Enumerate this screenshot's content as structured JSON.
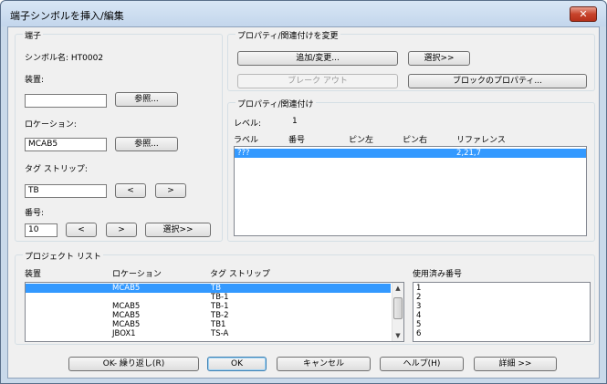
{
  "window": {
    "title": "端子シンボルを挿入/編集",
    "close_label": "✕"
  },
  "terminal": {
    "group_title": "端子",
    "symbol_name_label": "シンボル名: HT0002",
    "device_label": "装置:",
    "device_value": "",
    "browse_label": "参照...",
    "location_label": "ロケーション:",
    "location_value": "MCAB5",
    "location_browse_label": "参照...",
    "tagstrip_label": "タグ ストリップ:",
    "tagstrip_value": "TB",
    "prev_label": "<",
    "next_label": ">",
    "number_label": "番号:",
    "number_value": "10",
    "num_prev_label": "<",
    "num_next_label": ">",
    "select_label": "選択>>"
  },
  "properties_change": {
    "group_title": "プロパティ/関連付けを変更",
    "add_change_label": "追加/変更...",
    "select_label": "選択>>",
    "breakout_label": "ブレーク アウト",
    "block_properties_label": "ブロックのプロパティ..."
  },
  "properties": {
    "group_title": "プロパティ/関連付け",
    "level_label": "レベル:",
    "level_value": "1",
    "columns": [
      "ラベル",
      "番号",
      "ピン左",
      "ピン右",
      "リファレンス"
    ],
    "rows": [
      {
        "label": "???",
        "number": "",
        "pin_left": "",
        "pin_right": "",
        "reference": "2,21,7"
      }
    ]
  },
  "project_list": {
    "group_title": "プロジェクト リスト",
    "columns": {
      "device": "装置",
      "location": "ロケーション",
      "tagstrip": "タグ ストリップ",
      "used_numbers": "使用済み番号"
    },
    "rows": [
      {
        "device": "",
        "location": "MCAB5",
        "tagstrip": "TB"
      },
      {
        "device": "",
        "location": "",
        "tagstrip": "TB-1"
      },
      {
        "device": "",
        "location": "MCAB5",
        "tagstrip": "TB-1"
      },
      {
        "device": "",
        "location": "MCAB5",
        "tagstrip": "TB-2"
      },
      {
        "device": "",
        "location": "MCAB5",
        "tagstrip": "TB1"
      },
      {
        "device": "",
        "location": "JBOX1",
        "tagstrip": "TS-A"
      }
    ],
    "used_numbers": [
      "1",
      "2",
      "3",
      "4",
      "5",
      "6"
    ]
  },
  "footer": {
    "ok_repeat_label": "OK- 繰り返し(R)",
    "ok_label": "OK",
    "cancel_label": "キャンセル",
    "help_label": "ヘルプ(H)",
    "details_label": "詳細 >>"
  }
}
